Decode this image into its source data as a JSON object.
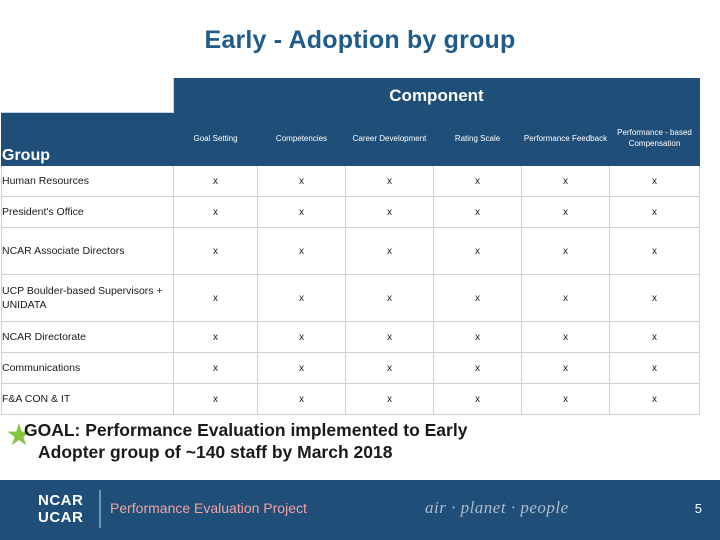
{
  "slide": {
    "title": "Early - Adoption by group",
    "page_number": "5"
  },
  "table": {
    "component_header": "Component",
    "group_header": "Group",
    "columns": [
      "Goal Setting",
      "Competencies",
      "Career Development",
      "Rating Scale",
      "Performance Feedback",
      "Performance - based Compensation"
    ],
    "mark": "x",
    "rows": [
      {
        "label": "Human Resources",
        "marks": [
          "x",
          "x",
          "x",
          "x",
          "x",
          "x"
        ]
      },
      {
        "label": "President's Office",
        "marks": [
          "x",
          "x",
          "x",
          "x",
          "x",
          "x"
        ]
      },
      {
        "label": "NCAR Associate Directors",
        "marks": [
          "x",
          "x",
          "x",
          "x",
          "x",
          "x"
        ]
      },
      {
        "label": "UCP Boulder-based Supervisors + UNIDATA",
        "marks": [
          "x",
          "x",
          "x",
          "x",
          "x",
          "x"
        ]
      },
      {
        "label": "NCAR Directorate",
        "marks": [
          "x",
          "x",
          "x",
          "x",
          "x",
          "x"
        ]
      },
      {
        "label": "Communications",
        "marks": [
          "x",
          "x",
          "x",
          "x",
          "x",
          "x"
        ]
      },
      {
        "label": "F&A CON & IT",
        "marks": [
          "x",
          "x",
          "x",
          "x",
          "x",
          "x"
        ]
      }
    ]
  },
  "goal": {
    "line1": "GOAL: Performance Evaluation implemented to Early",
    "line2": "Adopter group of ~140 staff by March 2018",
    "star_glyph": "★"
  },
  "footer": {
    "logo_line1": "NCAR",
    "logo_line2": "UCAR",
    "project_title": "Performance Evaluation Project",
    "tagline": "air · planet · people"
  },
  "colors": {
    "title_blue": "#1f5c8b",
    "header_navy": "#1f4e79",
    "footer_accent": "#f2a2a0",
    "star_green": "#86c440"
  }
}
